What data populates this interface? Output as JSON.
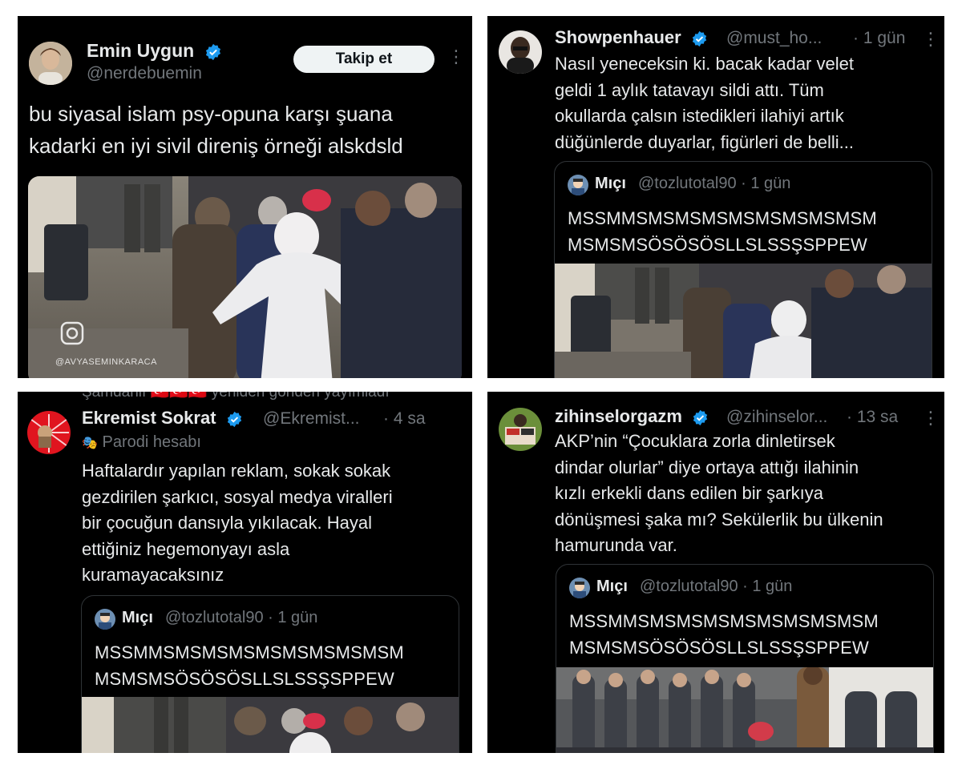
{
  "colors": {
    "background": "#000000",
    "text": "#e7e9ea",
    "muted": "#71767b",
    "verified": "#1d9bf0",
    "border": "#2f3336"
  },
  "tweet1": {
    "author": "Emin Uygun",
    "handle": "@nerdebuemin",
    "follow_label": "Takip et",
    "text_line1": "bu siyasal islam psy-opuna karşı şuana",
    "text_line2": "kadarki en iyi sivil direniş örneği alskdsld",
    "video_watermark": "@AVYASEMINKARACA",
    "icons": [
      "verified-icon",
      "more-icon",
      "instagram-icon"
    ]
  },
  "tweet2": {
    "author": "Showpenhauer",
    "handle": "@must_ho...",
    "time": "· 1 gün",
    "lines": [
      "Nasıl yeneceksin ki. bacak kadar velet",
      "geldi 1 aylık tatavayı sildi attı. Tüm",
      "okullarda çalsın istedikleri ilahiyi artık",
      "düğünlerde duyarlar, figürleri de belli..."
    ],
    "quote": {
      "author": "Mıçı",
      "handle": "@tozlutotal90 · 1 gün",
      "line1": "MSSMMSMSMSMSMSMSMSMSMSM",
      "line2": "MSMSMSÖSÖSÖSLLSLSSŞSPPEW"
    }
  },
  "tweet3": {
    "cut_header": "Şamdanlı 🇹🇷🇹🇷🇹🇷 yeniden gönderi yayımladı",
    "author": "Ekremist Sokrat",
    "handle": "@Ekremist...",
    "time": "· 4 sa",
    "parody_label": "Parodi hesabı",
    "lines": [
      "Haftalardır yapılan reklam, sokak sokak",
      "gezdirilen şarkıcı, sosyal medya viralleri",
      "bir çocuğun dansıyla yıkılacak. Hayal",
      "ettiğiniz hegemonyayı asla",
      "kuramayacaksınız"
    ],
    "quote": {
      "author": "Mıçı",
      "handle": "@tozlutotal90 · 1 gün",
      "line1": "MSSMMSMSMSMSMSMSMSMSMSM",
      "line2": "MSMSMSÖSÖSÖSLLSLSSŞSPPEW"
    }
  },
  "tweet4": {
    "author": "zihinselorgazm",
    "handle": "@zihinselor...",
    "time": "· 13 sa",
    "lines": [
      "AKP’nin “Çocuklara zorla dinletirsek",
      "dindar olurlar” diye ortaya attığı ilahinin",
      "kızlı erkekli dans edilen bir şarkıya",
      "dönüşmesi şaka mı? Sekülerlik bu ülkenin",
      "hamurunda var."
    ],
    "quote": {
      "author": "Mıçı",
      "handle": "@tozlutotal90 · 1 gün",
      "line1": "MSSMMSMSMSMSMSMSMSMSMSM",
      "line2": "MSMSMSÖSÖSÖSLLSLSSŞSPPEW"
    }
  }
}
